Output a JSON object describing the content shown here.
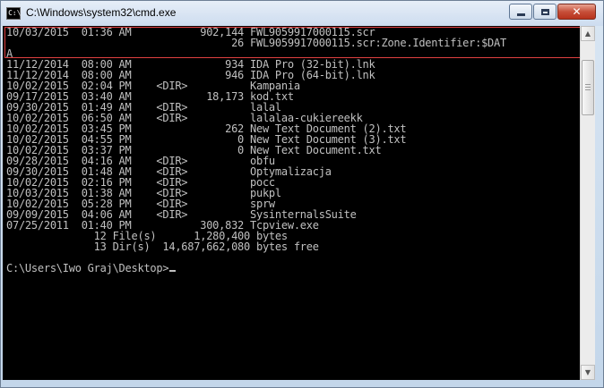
{
  "window": {
    "title": "C:\\Windows\\system32\\cmd.exe",
    "icon_label": "C:\\",
    "buttons": {
      "minimize": "minimize-icon",
      "maximize": "maximize-icon",
      "close": "close-icon",
      "close_glyph": "✕"
    }
  },
  "console": {
    "colors": {
      "background": "#000000",
      "foreground": "#c0c0c0",
      "highlight_box": "#e04040"
    },
    "lines": [
      "10/03/2015  01:36 AM           902,144 FWL9059917000115.scr",
      "                                    26 FWL9059917000115.scr:Zone.Identifier:$DAT",
      "A",
      "11/12/2014  08:00 AM               934 IDA Pro (32-bit).lnk",
      "11/12/2014  08:00 AM               946 IDA Pro (64-bit).lnk",
      "10/02/2015  02:04 PM    <DIR>          Kampania",
      "09/17/2015  03:40 AM            18,173 kod.txt",
      "09/30/2015  01:49 AM    <DIR>          lalal",
      "10/02/2015  06:50 AM    <DIR>          lalalaa-cukiereekk",
      "10/02/2015  03:45 PM               262 New Text Document (2).txt",
      "10/02/2015  04:55 PM                 0 New Text Document (3).txt",
      "10/02/2015  03:37 PM                 0 New Text Document.txt",
      "09/28/2015  04:16 AM    <DIR>          obfu",
      "09/30/2015  01:48 AM    <DIR>          Optymalizacja",
      "10/02/2015  02:16 PM    <DIR>          pocc",
      "10/03/2015  01:38 AM    <DIR>          pukpl",
      "10/02/2015  05:28 PM    <DIR>          sprw",
      "09/09/2015  04:06 AM    <DIR>          SysinternalsSuite",
      "07/25/2011  01:40 PM           300,832 Tcpview.exe",
      "              12 File(s)      1,280,400 bytes",
      "              13 Dir(s)  14,687,662,080 bytes free",
      "",
      "C:\\Users\\Iwo Graj\\Desktop>"
    ]
  },
  "scrollbar": {
    "up_arrow": "▲",
    "down_arrow": "▼",
    "up_icon": "scroll-up-arrow-icon",
    "down_icon": "scroll-down-arrow-icon"
  }
}
